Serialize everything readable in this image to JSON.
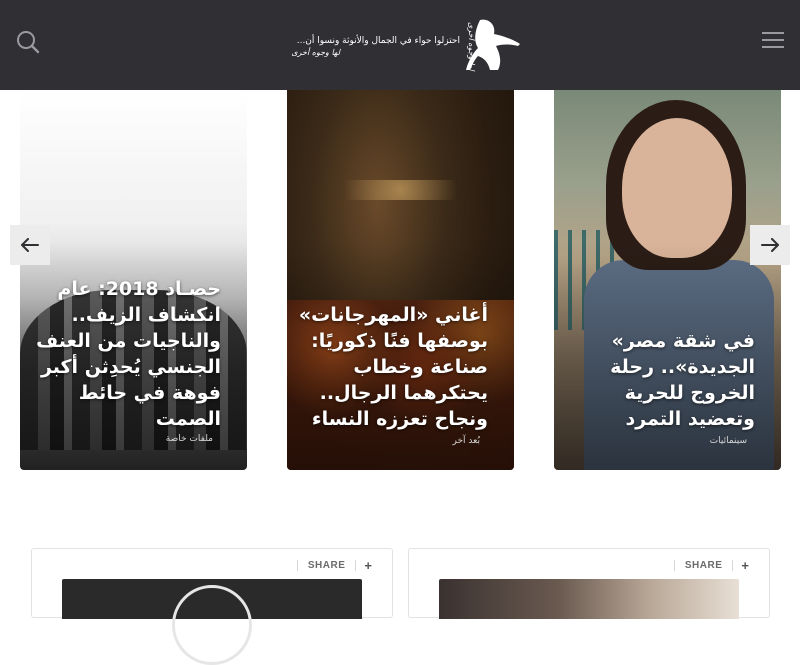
{
  "header": {
    "logo_line1": "احتزلوا حواء في الجمال والأنوثة ونسوا أن...",
    "logo_line2": "لها وجوه أخرى",
    "logo_vertical": "لها وجوه أخرى",
    "search_icon": "search-icon",
    "menu_icon": "hamburger-menu-icon"
  },
  "slider": {
    "prev_icon": "arrow-left-icon",
    "next_icon": "arrow-right-icon",
    "cards": [
      {
        "title": "حصـاد 2018: عام انكشاف الزيف.. والناجيات من العنف الجنسي يُحدِثن أكبر فوهة في حائط الصمت",
        "category": "ملفات خاصة"
      },
      {
        "title": "أغاني «المهرجانات» بوصفها فنًا ذكوريًا: صناعة وخطاب يحتكرهما الرجال.. ونجاح تعززه النساء",
        "category": "بُعد آخر"
      },
      {
        "title": "في شقة مصر» الجديدة».. رحلة الخروج للحرية وتعضيد التمرد",
        "category": "سينمائيات"
      }
    ]
  },
  "posts": [
    {
      "share_label": "SHARE",
      "plus": "+"
    },
    {
      "share_label": "SHARE",
      "plus": "+"
    }
  ],
  "colors": {
    "topbar": "#2f2f34",
    "arrow_bg": "#ececec"
  }
}
